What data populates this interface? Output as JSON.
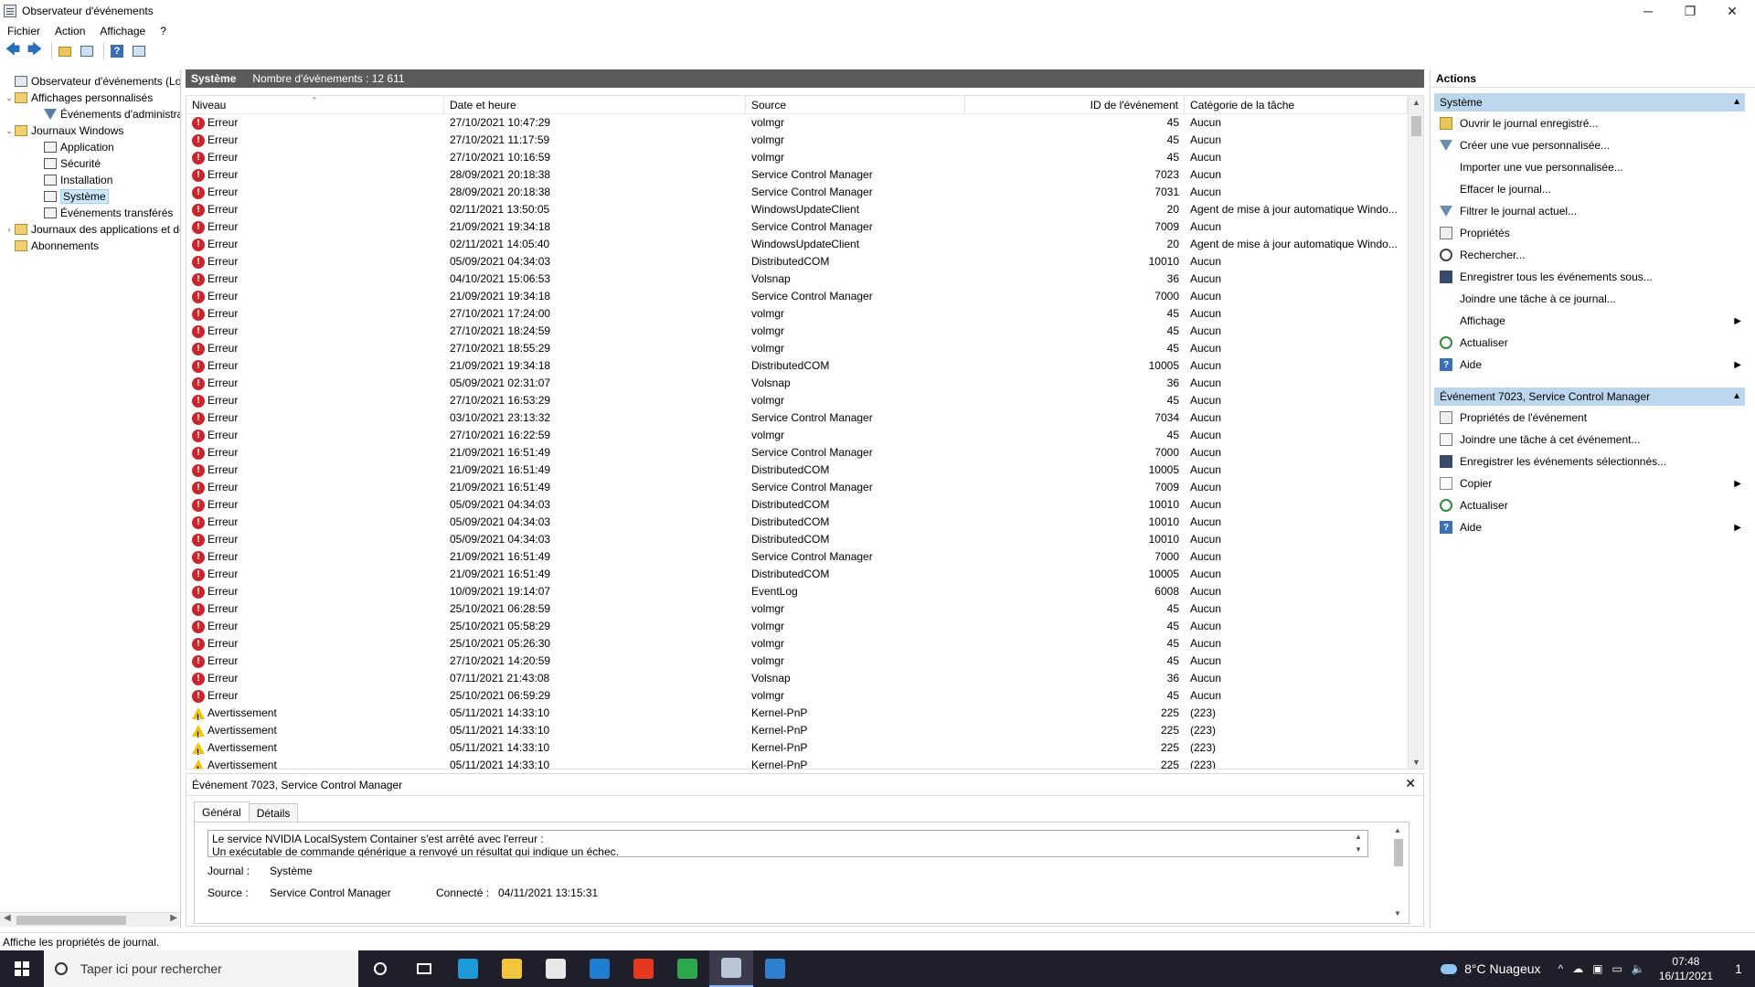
{
  "window": {
    "title": "Observateur d'événements",
    "controls": {
      "minimize": "─",
      "maximize": "❐",
      "close": "✕"
    }
  },
  "menu": [
    "Fichier",
    "Action",
    "Affichage",
    "?"
  ],
  "tree": [
    {
      "label": "Observateur d'événements (Local)",
      "level": 0,
      "toggle": "",
      "icon": "event-viewer-icon"
    },
    {
      "label": "Affichages personnalisés",
      "level": 0,
      "toggle": "⌄",
      "icon": "folder-icon"
    },
    {
      "label": "Événements d'administration",
      "level": 1,
      "toggle": "",
      "icon": "filter-icon"
    },
    {
      "label": "Journaux Windows",
      "level": 0,
      "toggle": "⌄",
      "icon": "folder-icon"
    },
    {
      "label": "Application",
      "level": 1,
      "toggle": "",
      "icon": "log-icon"
    },
    {
      "label": "Sécurité",
      "level": 1,
      "toggle": "",
      "icon": "log-icon"
    },
    {
      "label": "Installation",
      "level": 1,
      "toggle": "",
      "icon": "log-icon"
    },
    {
      "label": "Système",
      "level": 1,
      "toggle": "",
      "icon": "log-icon",
      "selected": true
    },
    {
      "label": "Événements transférés",
      "level": 1,
      "toggle": "",
      "icon": "log-icon"
    },
    {
      "label": "Journaux des applications et de services",
      "level": 0,
      "toggle": "›",
      "icon": "folder-icon"
    },
    {
      "label": "Abonnements",
      "level": 0,
      "toggle": "",
      "icon": "folder-icon"
    }
  ],
  "center": {
    "log_name": "Système",
    "count_text": "Nombre d'événements : 12 611"
  },
  "columns": [
    "Niveau",
    "Date et heure",
    "Source",
    "ID de l'événement",
    "Catégorie de la tâche"
  ],
  "rows": [
    [
      "Erreur",
      "27/10/2021 10:47:29",
      "volmgr",
      "45",
      "Aucun"
    ],
    [
      "Erreur",
      "27/10/2021 11:17:59",
      "volmgr",
      "45",
      "Aucun"
    ],
    [
      "Erreur",
      "27/10/2021 10:16:59",
      "volmgr",
      "45",
      "Aucun"
    ],
    [
      "Erreur",
      "28/09/2021 20:18:38",
      "Service Control Manager",
      "7023",
      "Aucun"
    ],
    [
      "Erreur",
      "28/09/2021 20:18:38",
      "Service Control Manager",
      "7031",
      "Aucun"
    ],
    [
      "Erreur",
      "02/11/2021 13:50:05",
      "WindowsUpdateClient",
      "20",
      "Agent de mise à jour automatique Windo..."
    ],
    [
      "Erreur",
      "21/09/2021 19:34:18",
      "Service Control Manager",
      "7009",
      "Aucun"
    ],
    [
      "Erreur",
      "02/11/2021 14:05:40",
      "WindowsUpdateClient",
      "20",
      "Agent de mise à jour automatique Windo..."
    ],
    [
      "Erreur",
      "05/09/2021 04:34:03",
      "DistributedCOM",
      "10010",
      "Aucun"
    ],
    [
      "Erreur",
      "04/10/2021 15:06:53",
      "Volsnap",
      "36",
      "Aucun"
    ],
    [
      "Erreur",
      "21/09/2021 19:34:18",
      "Service Control Manager",
      "7000",
      "Aucun"
    ],
    [
      "Erreur",
      "27/10/2021 17:24:00",
      "volmgr",
      "45",
      "Aucun"
    ],
    [
      "Erreur",
      "27/10/2021 18:24:59",
      "volmgr",
      "45",
      "Aucun"
    ],
    [
      "Erreur",
      "27/10/2021 18:55:29",
      "volmgr",
      "45",
      "Aucun"
    ],
    [
      "Erreur",
      "21/09/2021 19:34:18",
      "DistributedCOM",
      "10005",
      "Aucun"
    ],
    [
      "Erreur",
      "05/09/2021 02:31:07",
      "Volsnap",
      "36",
      "Aucun"
    ],
    [
      "Erreur",
      "27/10/2021 16:53:29",
      "volmgr",
      "45",
      "Aucun"
    ],
    [
      "Erreur",
      "03/10/2021 23:13:32",
      "Service Control Manager",
      "7034",
      "Aucun"
    ],
    [
      "Erreur",
      "27/10/2021 16:22:59",
      "volmgr",
      "45",
      "Aucun"
    ],
    [
      "Erreur",
      "21/09/2021 16:51:49",
      "Service Control Manager",
      "7000",
      "Aucun"
    ],
    [
      "Erreur",
      "21/09/2021 16:51:49",
      "DistributedCOM",
      "10005",
      "Aucun"
    ],
    [
      "Erreur",
      "21/09/2021 16:51:49",
      "Service Control Manager",
      "7009",
      "Aucun"
    ],
    [
      "Erreur",
      "05/09/2021 04:34:03",
      "DistributedCOM",
      "10010",
      "Aucun"
    ],
    [
      "Erreur",
      "05/09/2021 04:34:03",
      "DistributedCOM",
      "10010",
      "Aucun"
    ],
    [
      "Erreur",
      "05/09/2021 04:34:03",
      "DistributedCOM",
      "10010",
      "Aucun"
    ],
    [
      "Erreur",
      "21/09/2021 16:51:49",
      "Service Control Manager",
      "7000",
      "Aucun"
    ],
    [
      "Erreur",
      "21/09/2021 16:51:49",
      "DistributedCOM",
      "10005",
      "Aucun"
    ],
    [
      "Erreur",
      "10/09/2021 19:14:07",
      "EventLog",
      "6008",
      "Aucun"
    ],
    [
      "Erreur",
      "25/10/2021 06:28:59",
      "volmgr",
      "45",
      "Aucun"
    ],
    [
      "Erreur",
      "25/10/2021 05:58:29",
      "volmgr",
      "45",
      "Aucun"
    ],
    [
      "Erreur",
      "25/10/2021 05:26:30",
      "volmgr",
      "45",
      "Aucun"
    ],
    [
      "Erreur",
      "27/10/2021 14:20:59",
      "volmgr",
      "45",
      "Aucun"
    ],
    [
      "Erreur",
      "07/11/2021 21:43:08",
      "Volsnap",
      "36",
      "Aucun"
    ],
    [
      "Erreur",
      "25/10/2021 06:59:29",
      "volmgr",
      "45",
      "Aucun"
    ],
    [
      "Avertissement",
      "05/11/2021 14:33:10",
      "Kernel-PnP",
      "225",
      "(223)"
    ],
    [
      "Avertissement",
      "05/11/2021 14:33:10",
      "Kernel-PnP",
      "225",
      "(223)"
    ],
    [
      "Avertissement",
      "05/11/2021 14:33:10",
      "Kernel-PnP",
      "225",
      "(223)"
    ],
    [
      "Avertissement",
      "05/11/2021 14:33:10",
      "Kernel-PnP",
      "225",
      "(223)"
    ]
  ],
  "detail": {
    "title": "Événement 7023, Service Control Manager",
    "tabs": [
      "Général",
      "Détails"
    ],
    "description_line1": "Le service NVIDIA LocalSystem Container s'est arrêté avec l'erreur :",
    "description_line2": "Un exécutable de commande générique a renvoyé un résultat qui indique un échec.",
    "journal_label": "Journal :",
    "journal_value": "Système",
    "source_label": "Source :",
    "source_value": "Service Control Manager",
    "connected_label": "Connecté :",
    "connected_value": "04/11/2021 13:15:31"
  },
  "actions": {
    "title": "Actions",
    "section1": "Système",
    "items1": [
      {
        "label": "Ouvrir le journal enregistré...",
        "icon": "open-icon"
      },
      {
        "label": "Créer une vue personnalisée...",
        "icon": "filter-icon"
      },
      {
        "label": "Importer une vue personnalisée...",
        "icon": ""
      },
      {
        "label": "Effacer le journal...",
        "icon": ""
      },
      {
        "label": "Filtrer le journal actuel...",
        "icon": "filter-icon"
      },
      {
        "label": "Propriétés",
        "icon": "properties-icon"
      },
      {
        "label": "Rechercher...",
        "icon": "find-icon"
      },
      {
        "label": "Enregistrer tous les événements sous...",
        "icon": "save-icon"
      },
      {
        "label": "Joindre une tâche à ce journal...",
        "icon": ""
      },
      {
        "label": "Affichage",
        "icon": "",
        "submenu": true
      },
      {
        "label": "Actualiser",
        "icon": "refresh-icon"
      },
      {
        "label": "Aide",
        "icon": "help-icon",
        "submenu": true
      }
    ],
    "section2": "Événement 7023, Service Control Manager",
    "items2": [
      {
        "label": "Propriétés de l'événement",
        "icon": "properties-icon"
      },
      {
        "label": "Joindre une tâche à cet événement...",
        "icon": "task-icon"
      },
      {
        "label": "Enregistrer les événements sélectionnés...",
        "icon": "save-icon"
      },
      {
        "label": "Copier",
        "icon": "copy-icon",
        "submenu": true
      },
      {
        "label": "Actualiser",
        "icon": "refresh-icon"
      },
      {
        "label": "Aide",
        "icon": "help-icon",
        "submenu": true
      }
    ]
  },
  "status": "Affiche les propriétés de journal.",
  "taskbar": {
    "search_placeholder": "Taper ici pour rechercher",
    "weather": "8°C  Nuageux",
    "time": "07:48",
    "date": "16/11/2021",
    "notification_count": "1",
    "apps": [
      {
        "name": "edge-icon",
        "color": "#1c9bd8"
      },
      {
        "name": "file-explorer-icon",
        "color": "#f2c53d"
      },
      {
        "name": "store-icon",
        "color": "#e8e8e8"
      },
      {
        "name": "mail-icon",
        "color": "#1e7fd1"
      },
      {
        "name": "office-icon",
        "color": "#e5391d"
      },
      {
        "name": "chrome-icon",
        "color": "#2da94f"
      },
      {
        "name": "event-viewer-app-icon",
        "color": "#b8c6d8"
      },
      {
        "name": "photos-icon",
        "color": "#2f7fd1"
      }
    ]
  }
}
